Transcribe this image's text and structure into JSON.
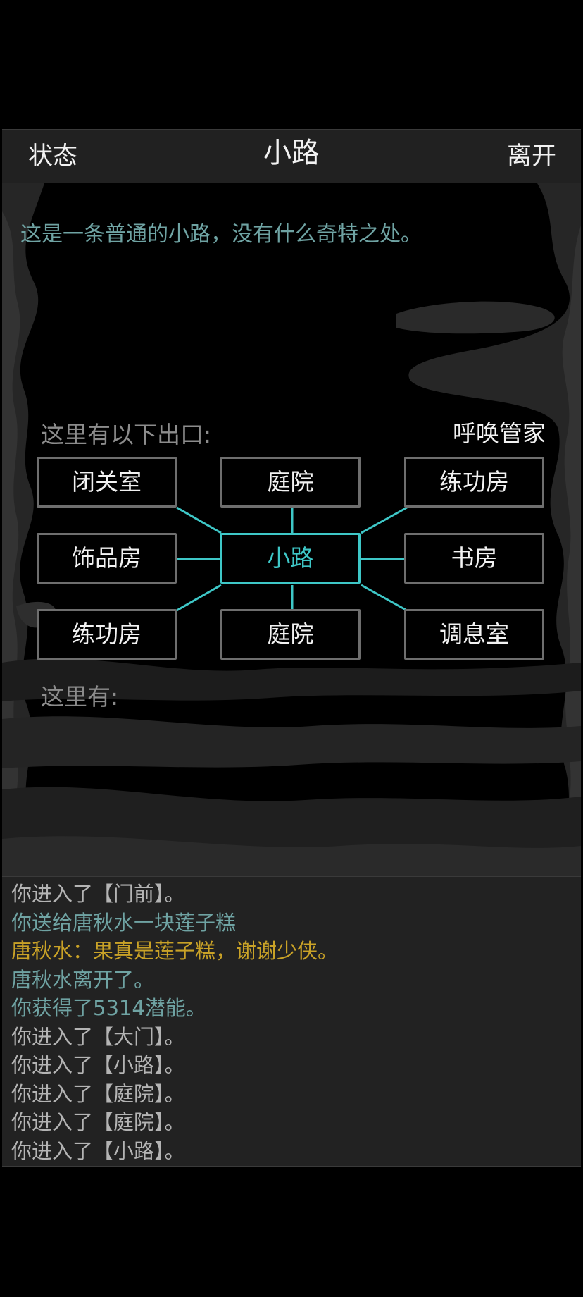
{
  "header": {
    "left_label": "状态",
    "title": "小路",
    "right_label": "离开"
  },
  "room": {
    "description": "这是一条普通的小路，没有什么奇特之处。",
    "exits_label": "这里有以下出口:",
    "call_label": "呼唤管家",
    "here_label": "这里有:"
  },
  "map": {
    "current": "小路",
    "exits": {
      "northwest": "闭关室",
      "north": "庭院",
      "northeast": "练功房",
      "west": "饰品房",
      "east": "书房",
      "southwest": "练功房",
      "south": "庭院",
      "southeast": "调息室"
    }
  },
  "log": [
    {
      "text": "你进入了【门前】。",
      "color": "#b4b4b4"
    },
    {
      "text": "你送给唐秋水一块莲子糕",
      "color": "#6fa3a3"
    },
    {
      "text": "唐秋水：果真是莲子糕，谢谢少侠。",
      "color": "#c9a227"
    },
    {
      "text": "唐秋水离开了。",
      "color": "#6fa3a3"
    },
    {
      "text": "你获得了5314潜能。",
      "color": "#6fa3a3"
    },
    {
      "text": "你进入了【大门】。",
      "color": "#b4b4b4"
    },
    {
      "text": "你进入了【小路】。",
      "color": "#b4b4b4"
    },
    {
      "text": "你进入了【庭院】。",
      "color": "#b4b4b4"
    },
    {
      "text": "你进入了【庭院】。",
      "color": "#b4b4b4"
    },
    {
      "text": "你进入了【小路】。",
      "color": "#b4b4b4"
    }
  ],
  "colors": {
    "accent": "#3ec7c7",
    "narration": "#6fa3a3",
    "dialogue": "#c9a227",
    "system": "#b4b4b4"
  }
}
